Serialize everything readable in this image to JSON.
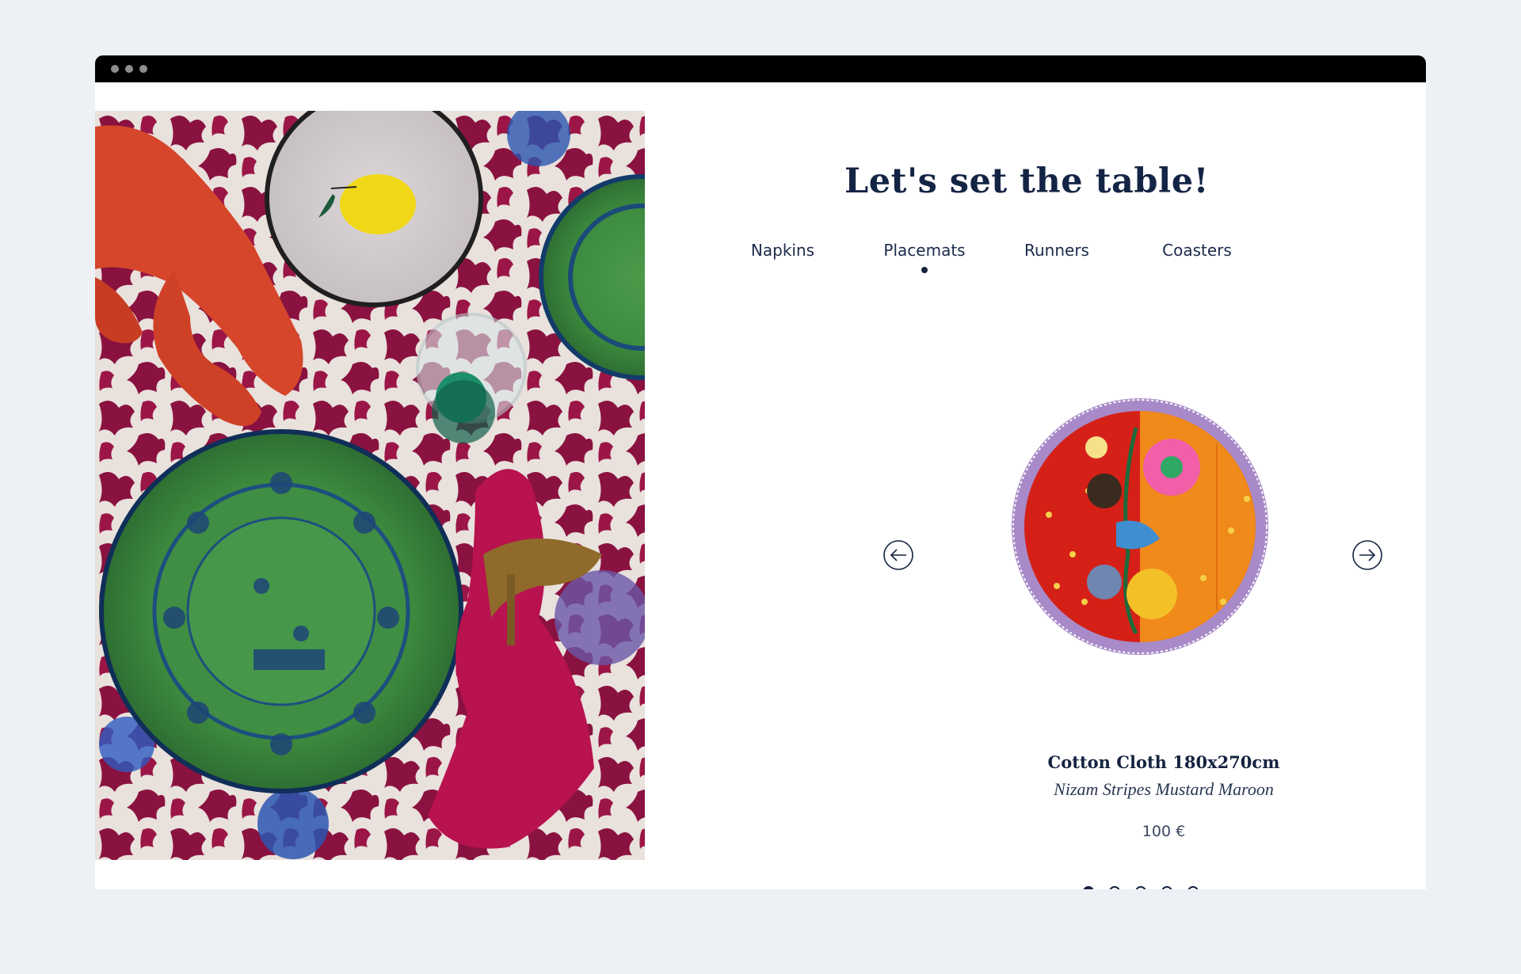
{
  "window": {
    "controls": [
      "dot",
      "dot",
      "dot"
    ]
  },
  "page": {
    "title": "Let's set the table!"
  },
  "tabs": [
    {
      "label": "Napkins",
      "active": false
    },
    {
      "label": "Placemats",
      "active": true
    },
    {
      "label": "Runners",
      "active": false
    },
    {
      "label": "Coasters",
      "active": false
    }
  ],
  "carousel": {
    "prev_icon": "arrow-left-circle-icon",
    "next_icon": "arrow-right-circle-icon",
    "current_page": 1,
    "total_pages": 5
  },
  "product": {
    "name": "Cotton Cloth 180x270cm",
    "variant": "Nizam Stripes Mustard Maroon",
    "price": "100 €"
  },
  "colors": {
    "navy": "#14233f",
    "background": "#edf0f5",
    "titlebar": "#000000"
  }
}
